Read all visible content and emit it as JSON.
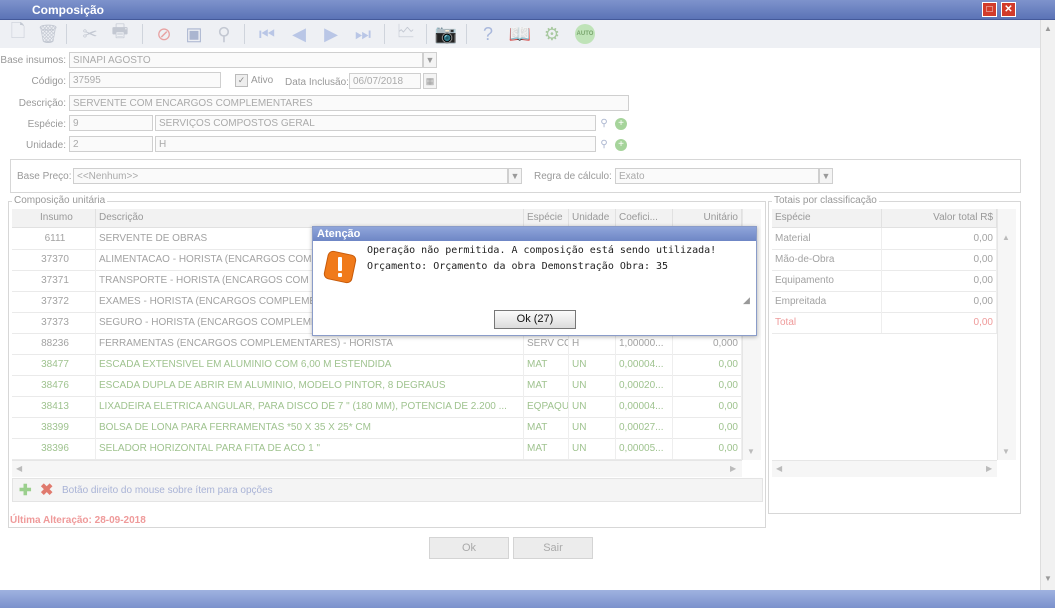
{
  "window": {
    "title": "Composição"
  },
  "form": {
    "base_insumos_label": "Base insumos:",
    "base_insumos_value": "SINAPI AGOSTO",
    "codigo_label": "Código:",
    "codigo_value": "37595",
    "ativo_label": "Ativo",
    "ativo_checked": true,
    "data_inclusao_label": "Data Inclusão:",
    "data_inclusao_value": "06/07/2018",
    "descricao_label": "Descrição:",
    "descricao_value": "SERVENTE COM ENCARGOS COMPLEMENTARES",
    "especie_label": "Espécie:",
    "especie_code": "9",
    "especie_name": "SERVIÇOS COMPOSTOS GERAL",
    "unidade_label": "Unidade:",
    "unidade_code": "2",
    "unidade_name": "H",
    "base_preco_label": "Base Preço:",
    "base_preco_value": "<<Nenhum>>",
    "regra_label": "Regra de cálculo:",
    "regra_value": "Exato"
  },
  "composicao": {
    "legend": "Composição unitária",
    "columns": [
      "Insumo",
      "Descrição",
      "Espécie",
      "Unidade",
      "Coefici...",
      "Unitário"
    ],
    "rows": [
      {
        "insumo": "6111",
        "descricao": "SERVENTE DE OBRAS",
        "especie": "",
        "unidade": "",
        "coef": "",
        "unitario": "",
        "style": "grey"
      },
      {
        "insumo": "37370",
        "descricao": "ALIMENTACAO - HORISTA (ENCARGOS COM",
        "especie": "",
        "unidade": "",
        "coef": "",
        "unitario": "",
        "style": "grey"
      },
      {
        "insumo": "37371",
        "descricao": "TRANSPORTE - HORISTA (ENCARGOS COM",
        "especie": "",
        "unidade": "",
        "coef": "",
        "unitario": "",
        "style": "grey"
      },
      {
        "insumo": "37372",
        "descricao": "EXAMES - HORISTA (ENCARGOS COMPLEME",
        "especie": "",
        "unidade": "",
        "coef": "",
        "unitario": "",
        "style": "grey"
      },
      {
        "insumo": "37373",
        "descricao": "SEGURO - HORISTA (ENCARGOS COMPLEME",
        "especie": "",
        "unidade": "",
        "coef": "",
        "unitario": "",
        "style": "grey"
      },
      {
        "insumo": "88236",
        "descricao": "FERRAMENTAS (ENCARGOS COMPLEMENTARES) - HORISTA",
        "especie": "SERV CO",
        "unidade": "H",
        "coef": "1,00000...",
        "unitario": "0,000",
        "style": "grey"
      },
      {
        "insumo": "38477",
        "descricao": "ESCADA EXTENSIVEL EM ALUMINIO COM 6,00 M ESTENDIDA",
        "especie": "MAT",
        "unidade": "UN",
        "coef": "0,00004...",
        "unitario": "0,00",
        "style": "green"
      },
      {
        "insumo": "38476",
        "descricao": "ESCADA DUPLA DE ABRIR EM ALUMINIO, MODELO PINTOR, 8 DEGRAUS",
        "especie": "MAT",
        "unidade": "UN",
        "coef": "0,00020...",
        "unitario": "0,00",
        "style": "green"
      },
      {
        "insumo": "38413",
        "descricao": "LIXADEIRA ELETRICA ANGULAR, PARA DISCO DE 7 \" (180 MM), POTENCIA DE 2.200 ...",
        "especie": "EQPAQU",
        "unidade": "UN",
        "coef": "0,00004...",
        "unitario": "0,00",
        "style": "green"
      },
      {
        "insumo": "38399",
        "descricao": "BOLSA DE LONA PARA FERRAMENTAS *50 X 35 X 25* CM",
        "especie": "MAT",
        "unidade": "UN",
        "coef": "0,00027...",
        "unitario": "0,00",
        "style": "green"
      },
      {
        "insumo": "38396",
        "descricao": "SELADOR HORIZONTAL PARA FITA DE ACO 1 \"",
        "especie": "MAT",
        "unidade": "UN",
        "coef": "0,00005...",
        "unitario": "0,00",
        "style": "green"
      }
    ],
    "hint": "Botão direito do mouse sobre ítem para opções"
  },
  "totais": {
    "legend": "Totais por classificação",
    "columns": [
      "Espécie",
      "Valor total R$"
    ],
    "rows": [
      {
        "especie": "Material",
        "valor": "0,00"
      },
      {
        "especie": "Mão-de-Obra",
        "valor": "0,00"
      },
      {
        "especie": "Equipamento",
        "valor": "0,00"
      },
      {
        "especie": "Empreitada",
        "valor": "0,00"
      },
      {
        "especie": "Total",
        "valor": "0,00"
      }
    ]
  },
  "footer": {
    "ultima_alteracao": "Última Alteração: 28-09-2018",
    "ok_label": "Ok",
    "sair_label": "Sair"
  },
  "dialog": {
    "title": "Atenção",
    "line1": "Operação não permitida. A composição está sendo utilizada!",
    "line2": "Orçamento: Orçamento da obra Demonstração Obra: 35",
    "ok_label": "Ok (27)",
    "accent": "#f07a1a"
  },
  "toolbar": {
    "icons": [
      "new-icon",
      "delete-icon",
      "cut-icon",
      "print-icon",
      "cancel-icon",
      "save-icon",
      "search-icon",
      "first-icon",
      "prev-icon",
      "next-icon",
      "last-icon",
      "report-icon",
      "camera-icon",
      "help-icon",
      "book-icon",
      "tools-icon",
      "auto-icon"
    ],
    "auto_label": "AUTO"
  }
}
